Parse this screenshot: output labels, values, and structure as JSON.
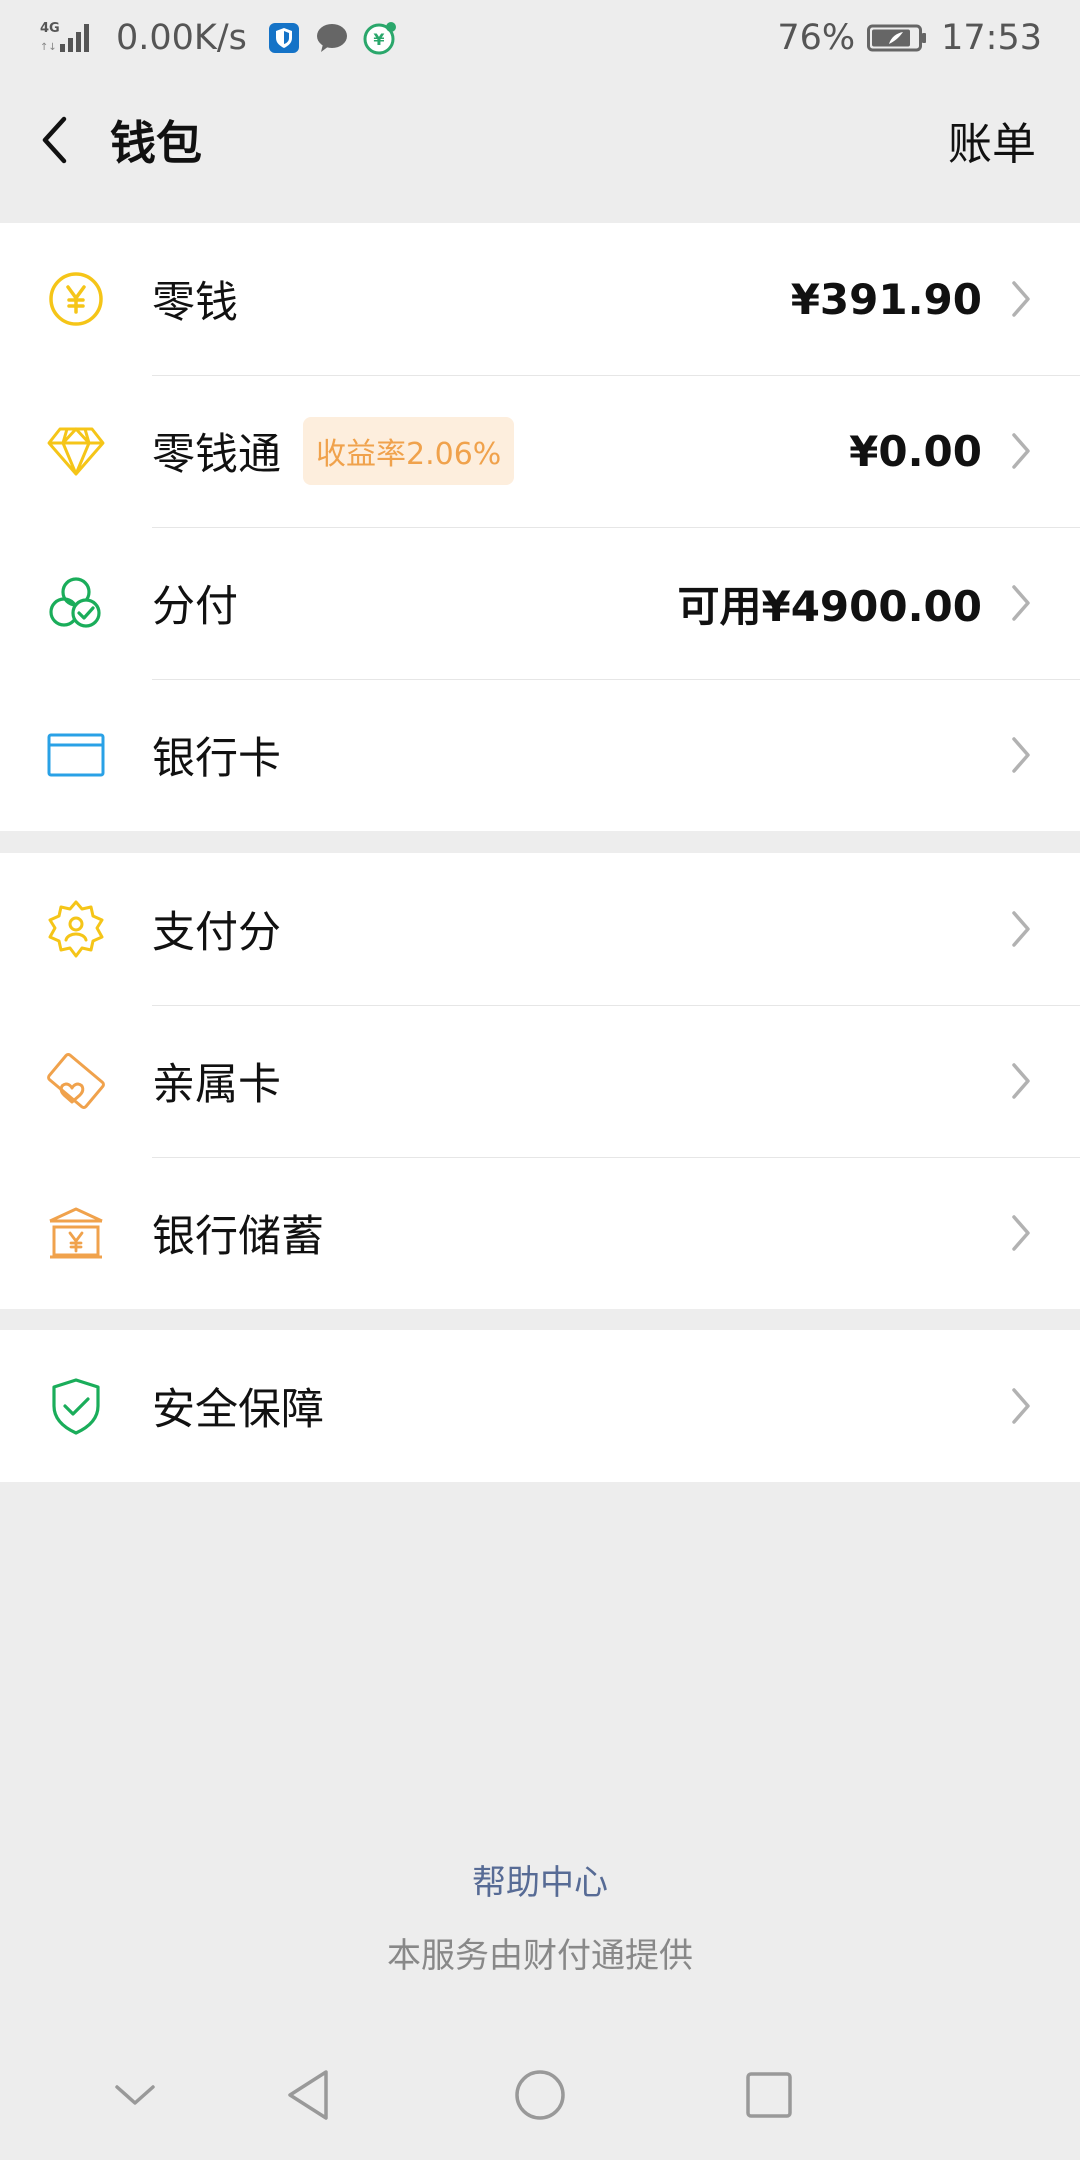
{
  "status_bar": {
    "network_type": "4G",
    "net_speed": "0.00K/s",
    "battery_percent": "76%",
    "time": "17:53"
  },
  "header": {
    "title": "钱包",
    "bill_label": "账单"
  },
  "group1": [
    {
      "label": "零钱",
      "value": "¥391.90",
      "icon": "yuan-coin-icon",
      "color": "#f5c518"
    },
    {
      "label": "零钱通",
      "badge": "收益率2.06%",
      "value": "¥0.00",
      "icon": "diamond-icon",
      "color": "#f5c518"
    },
    {
      "label": "分付",
      "value": "可用¥4900.00",
      "icon": "fenfu-icon",
      "color": "#1aad5a"
    },
    {
      "label": "银行卡",
      "value": "",
      "icon": "card-icon",
      "color": "#29a1e6"
    }
  ],
  "group2": [
    {
      "label": "支付分",
      "icon": "pay-score-icon",
      "color": "#f5c518"
    },
    {
      "label": "亲属卡",
      "icon": "family-card-icon",
      "color": "#f0a24c"
    },
    {
      "label": "银行储蓄",
      "icon": "bank-savings-icon",
      "color": "#f0a24c"
    }
  ],
  "group3": [
    {
      "label": "安全保障",
      "icon": "shield-check-icon",
      "color": "#1aad5a"
    }
  ],
  "footer": {
    "help_link": "帮助中心",
    "service_note": "本服务由财付通提供"
  },
  "colors": {
    "background": "#ededed",
    "link": "#576b95",
    "badge_bg": "#fdeedd",
    "badge_text": "#f0a24c"
  }
}
